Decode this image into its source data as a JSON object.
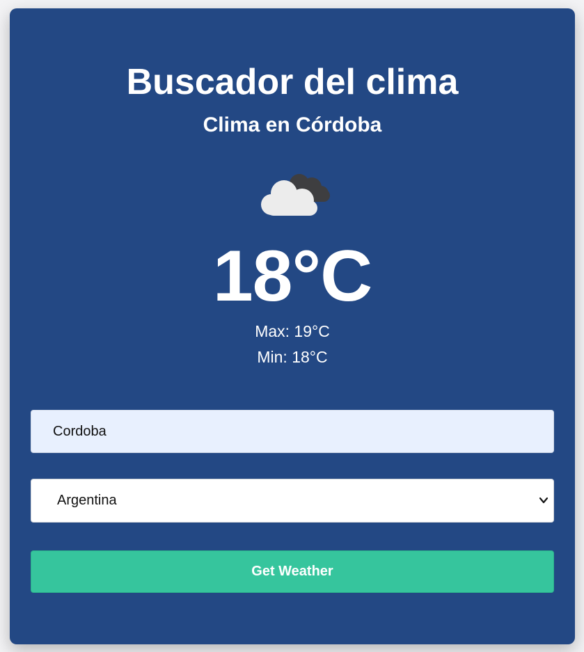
{
  "header": {
    "title": "Buscador del clima",
    "subtitle": "Clima en Córdoba"
  },
  "weather": {
    "icon": "cloudy-night-icon",
    "temperature": "18°C",
    "max": "Max: 19°C",
    "min": "Min: 18°C"
  },
  "form": {
    "city_value": "Cordoba",
    "country_selected": "Argentina",
    "submit_label": "Get Weather"
  },
  "colors": {
    "card_background": "#234884",
    "button_background": "#36c59d",
    "input_background": "#e8f0fe"
  }
}
